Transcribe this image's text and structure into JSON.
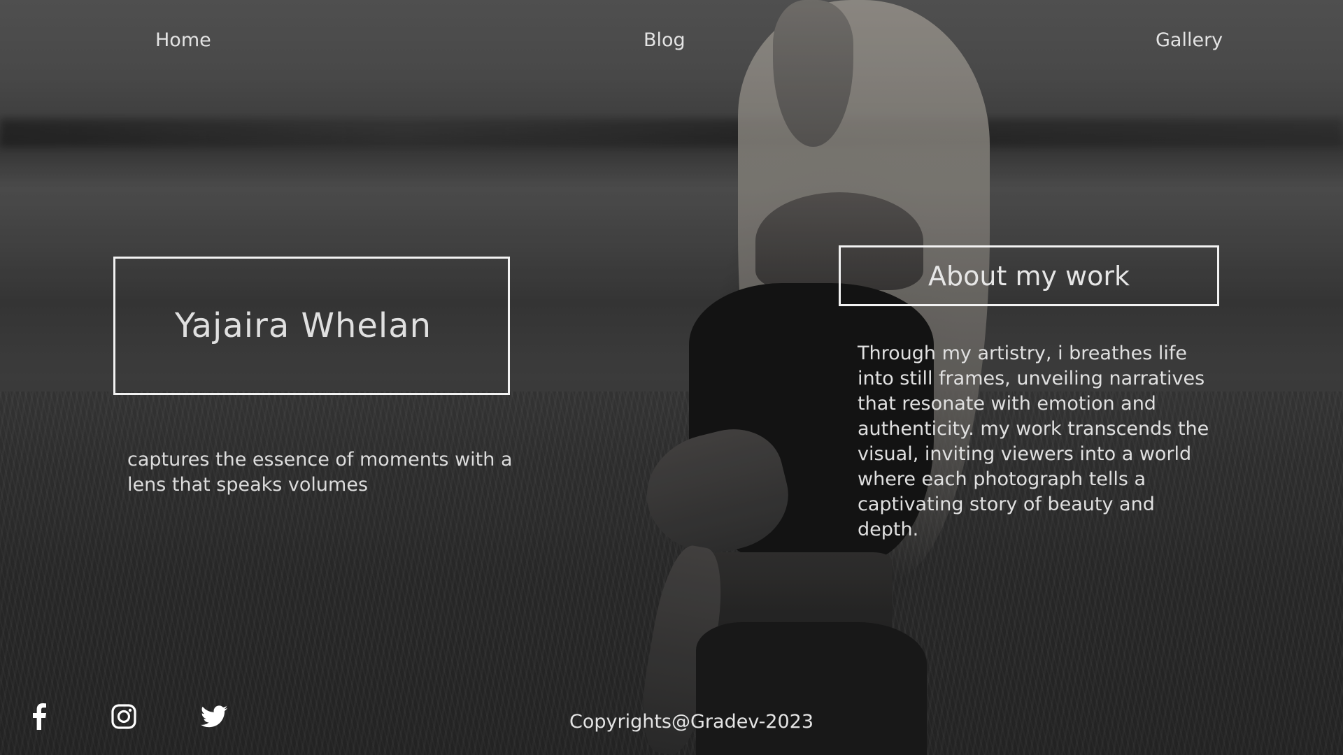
{
  "nav": {
    "home": "Home",
    "blog": "Blog",
    "gallery": "Gallery"
  },
  "hero": {
    "name": "Yajaira Whelan",
    "tagline": "captures the essence of moments with a lens that speaks volumes"
  },
  "about": {
    "title": "About my work",
    "body": "Through my artistry, i breathes life into still frames, unveiling narratives that resonate with emotion and authenticity. my work transcends the visual, inviting viewers into a world where each photograph tells a captivating story of beauty and depth."
  },
  "footer": {
    "social": [
      "facebook-icon",
      "instagram-icon",
      "twitter-icon"
    ],
    "copyright": "Copyrights@Gradev-2023"
  },
  "colors": {
    "text": "#e4e4e4",
    "border": "#f2f2f2",
    "background": "#3a3a3a"
  }
}
